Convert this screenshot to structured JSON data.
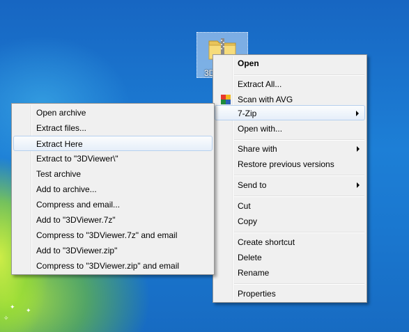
{
  "desktop": {
    "icon_label": "3D"
  },
  "context_menu": {
    "items": {
      "open": "Open",
      "extract_all": "Extract All...",
      "scan_avg": "Scan with AVG",
      "seven_zip": "7-Zip",
      "open_with": "Open with...",
      "share_with": "Share with",
      "restore": "Restore previous versions",
      "send_to": "Send to",
      "cut": "Cut",
      "copy": "Copy",
      "create_shortcut": "Create shortcut",
      "delete": "Delete",
      "rename": "Rename",
      "properties": "Properties"
    }
  },
  "seven_zip_menu": {
    "items": [
      "Open archive",
      "Extract files...",
      "Extract Here",
      "Extract to \"3DViewer\\\"",
      "Test archive",
      "Add to archive...",
      "Compress and email...",
      "Add to \"3DViewer.7z\"",
      "Compress to \"3DViewer.7z\" and email",
      "Add to \"3DViewer.zip\"",
      "Compress to \"3DViewer.zip\" and email"
    ],
    "highlighted": "Extract Here"
  },
  "colors": {
    "desktop_blue": "#1a72c8",
    "menu_bg": "#f0f0f0",
    "hover_border": "#b6d0ee"
  },
  "icons": {
    "zip_folder": "zip-folder-icon",
    "avg": "avg-icon",
    "submenu_arrow": "chevron-right-icon"
  }
}
